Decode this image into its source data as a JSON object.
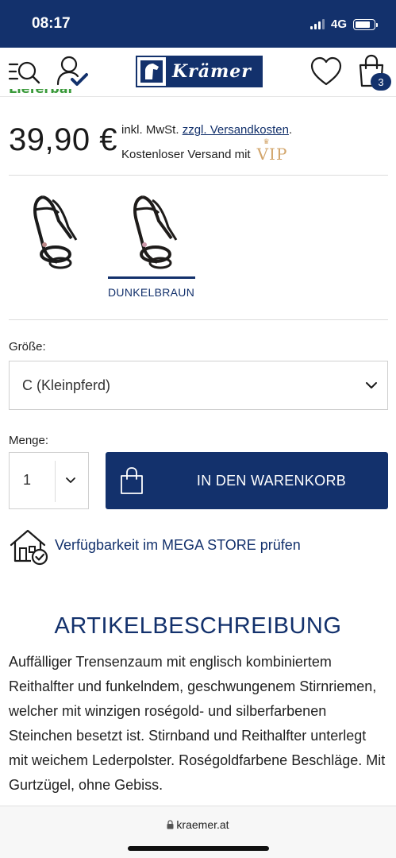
{
  "status_bar": {
    "time": "08:17",
    "network": "4G"
  },
  "header": {
    "logo_text": "Krämer",
    "cart_count": "3",
    "icons": [
      "menu-search-icon",
      "account-check-icon",
      "wishlist-heart-icon",
      "shopping-bag-icon"
    ]
  },
  "product": {
    "availability": "Lieferbar",
    "price": "39,90 €",
    "tax_prefix": "inkl. MwSt. ",
    "tax_link": "zzgl. Versandkosten",
    "tax_suffix": ".",
    "shipping_text": "Kostenloser Versand mit",
    "vip_label": "VIP"
  },
  "variants": {
    "selected_label": "DUNKELBRAUN"
  },
  "size": {
    "label": "Größe:",
    "selected": "C (Kleinpferd)"
  },
  "quantity": {
    "label": "Menge:",
    "value": "1"
  },
  "cart_button": {
    "label": "IN DEN WARENKORB"
  },
  "store_check": {
    "label": "Verfügbarkeit im MEGA STORE prüfen"
  },
  "description": {
    "title": "ARTIKELBESCHREIBUNG",
    "text": "Auffälliger Trensenzaum mit englisch kombiniertem Reithalfter und funkelndem, geschwungenem Stirnriemen, welcher mit winzigen roségold- und silberfarbenen Steinchen besetzt ist. Stirnband und Reithalfter unterlegt mit weichem Lederpolster. Roségoldfarbene Beschläge. Mit Gurtzügel, ohne Gebiss."
  },
  "browser": {
    "url": "kraemer.at"
  },
  "colors": {
    "brand_navy": "#13316c",
    "availability_green": "#3a9a3a",
    "vip_gold": "#d2a56b"
  }
}
